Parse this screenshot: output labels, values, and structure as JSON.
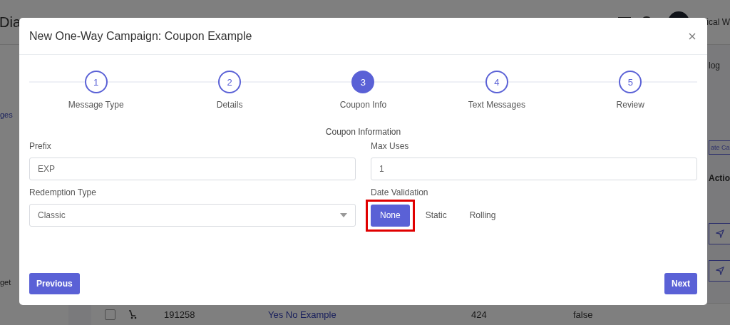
{
  "background": {
    "title": "Dia",
    "user": "ical W",
    "sidebar": [
      "ges",
      "get"
    ],
    "tab": "log",
    "create_button": "ate Ca",
    "column": "Actio",
    "row": {
      "checked": false,
      "id": "191258",
      "name": "Yes No Example",
      "count": "424",
      "flag": "false"
    }
  },
  "modal": {
    "title": "New One-Way Campaign: Coupon Example",
    "steps": [
      {
        "number": "1",
        "label": "Message Type",
        "selected": false
      },
      {
        "number": "2",
        "label": "Details",
        "selected": false
      },
      {
        "number": "3",
        "label": "Coupon Info",
        "selected": true
      },
      {
        "number": "4",
        "label": "Text Messages",
        "selected": false
      },
      {
        "number": "5",
        "label": "Review",
        "selected": false
      }
    ],
    "section": "Coupon Information",
    "fields": [
      {
        "kind": "text",
        "label": "Prefix",
        "value": "EXP"
      },
      {
        "kind": "text",
        "label": "Max Uses",
        "value": "1"
      },
      {
        "kind": "select",
        "label": "Redemption Type",
        "value": "Classic"
      },
      {
        "kind": "options",
        "label": "Date Validation",
        "options": [
          {
            "label": "None",
            "selected": true,
            "highlighted": true
          },
          {
            "label": "Static",
            "selected": false,
            "highlighted": false
          },
          {
            "label": "Rolling",
            "selected": false,
            "highlighted": false
          }
        ]
      }
    ],
    "previous": "Previous",
    "next": "Next"
  }
}
